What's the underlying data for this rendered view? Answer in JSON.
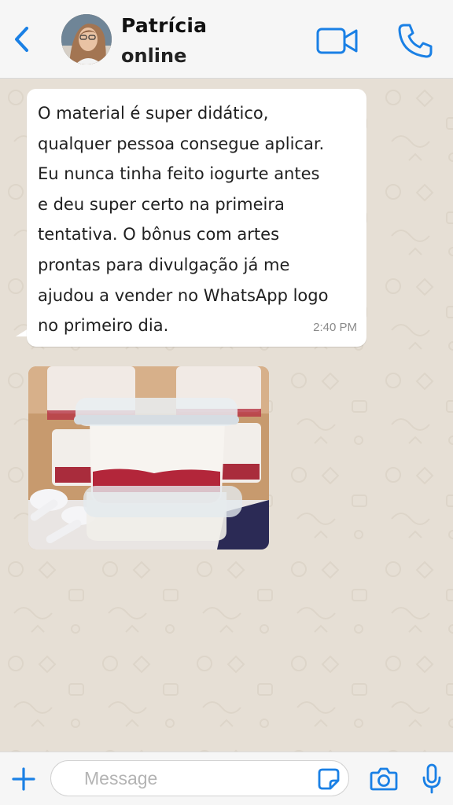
{
  "header": {
    "contact_name": "Patrícia",
    "status": "online",
    "back_icon": "chevron-left-icon",
    "video_icon": "video-call-icon",
    "call_icon": "phone-icon"
  },
  "messages": [
    {
      "text": "O material é super didático,\nqualquer pessoa consegue aplicar.\nEu nunca tinha feito iogurte antes\ne deu super certo na primeira\ntentativa. O bônus com artes\nprontas para divulgação já me\najudou a vender no WhatsApp logo\nno primeiro dia.",
      "time": "2:40 PM"
    }
  ],
  "photo": {
    "subject": "yogurt-cups-with-red-fruit-jam-photo"
  },
  "footer": {
    "placeholder": "Message",
    "value": "",
    "plus_icon": "plus-icon",
    "sticker_icon": "sticker-icon",
    "camera_icon": "camera-icon",
    "mic_icon": "microphone-icon"
  },
  "colors": {
    "accent": "#1a80e5",
    "chat_background": "#e6dfd5",
    "bar_background": "#f6f6f6",
    "bubble": "#ffffff"
  }
}
